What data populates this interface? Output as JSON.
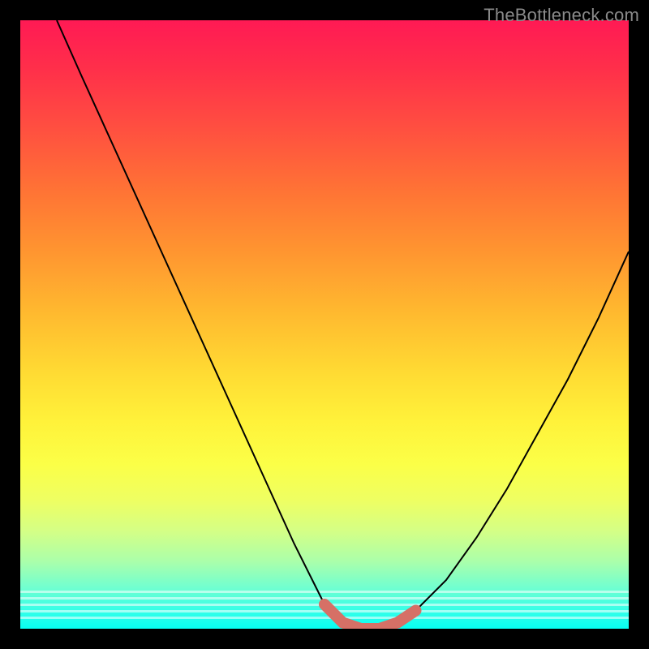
{
  "attribution": "TheBottleneck.com",
  "chart_data": {
    "type": "line",
    "title": "",
    "xlabel": "",
    "ylabel": "",
    "xlim": [
      0,
      100
    ],
    "ylim": [
      0,
      100
    ],
    "series": [
      {
        "name": "curve-main",
        "x": [
          6,
          10,
          15,
          20,
          25,
          30,
          35,
          40,
          45,
          48,
          50,
          53,
          56,
          59,
          62,
          65,
          70,
          75,
          80,
          85,
          90,
          95,
          100
        ],
        "values": [
          100,
          91,
          80,
          69,
          58,
          47,
          36,
          25,
          14,
          8,
          4,
          1,
          0,
          0,
          1,
          3,
          8,
          15,
          23,
          32,
          41,
          51,
          62
        ]
      },
      {
        "name": "highlight-minimum",
        "x": [
          50,
          53,
          56,
          59,
          62,
          65
        ],
        "values": [
          4,
          1,
          0,
          0,
          1,
          3
        ]
      }
    ],
    "gradient_stops": [
      {
        "pos": 0,
        "color": "#ff1a54"
      },
      {
        "pos": 18,
        "color": "#ff5040"
      },
      {
        "pos": 38,
        "color": "#ff9530"
      },
      {
        "pos": 58,
        "color": "#ffdb33"
      },
      {
        "pos": 73,
        "color": "#fbff47"
      },
      {
        "pos": 89,
        "color": "#aaffab"
      },
      {
        "pos": 100,
        "color": "#07fff2"
      }
    ]
  }
}
